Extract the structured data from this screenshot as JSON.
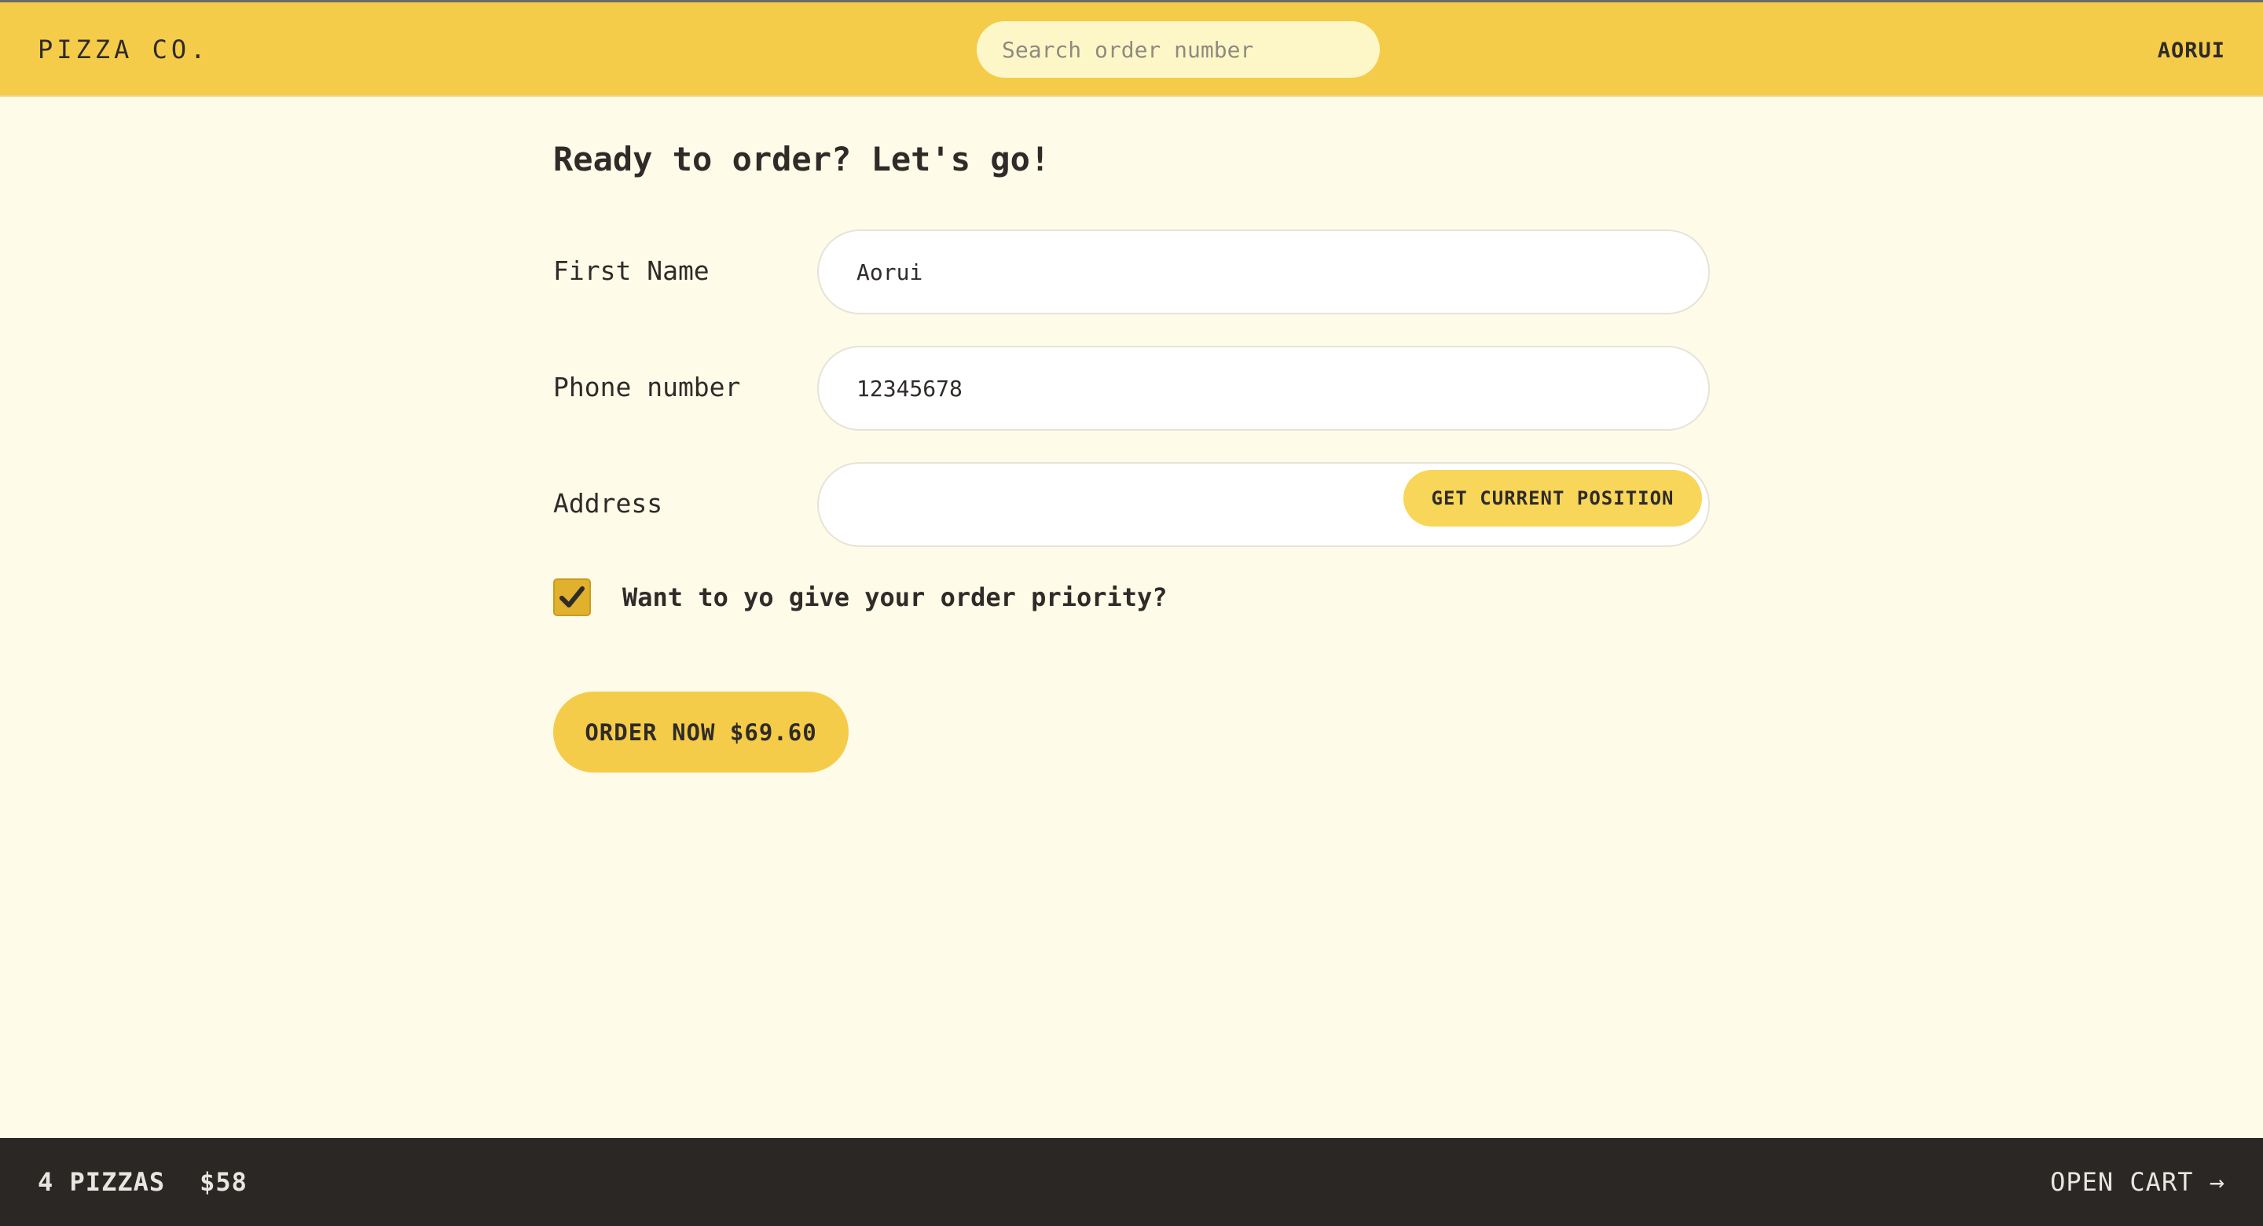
{
  "header": {
    "logo": "PIZZA CO.",
    "search_placeholder": "Search order number",
    "username": "AORUI"
  },
  "form": {
    "title": "Ready to order? Let's go!",
    "first_name": {
      "label": "First Name",
      "value": "Aorui"
    },
    "phone": {
      "label": "Phone number",
      "value": "12345678"
    },
    "address": {
      "label": "Address",
      "value": ""
    },
    "geo_button": "GET CURRENT POSITION",
    "priority": {
      "label": "Want to yo give your order priority?",
      "checked": true
    },
    "submit": "ORDER NOW $69.60"
  },
  "footer": {
    "pizza_count": "4 PIZZAS",
    "total": "$58",
    "open_cart": "OPEN CART →"
  },
  "colors": {
    "header_bg": "#f5cc49",
    "page_bg": "#fefbe8",
    "footer_bg": "#2b2725",
    "accent": "#f5cc49"
  },
  "icons": {
    "checkbox": "checkmark-icon"
  }
}
